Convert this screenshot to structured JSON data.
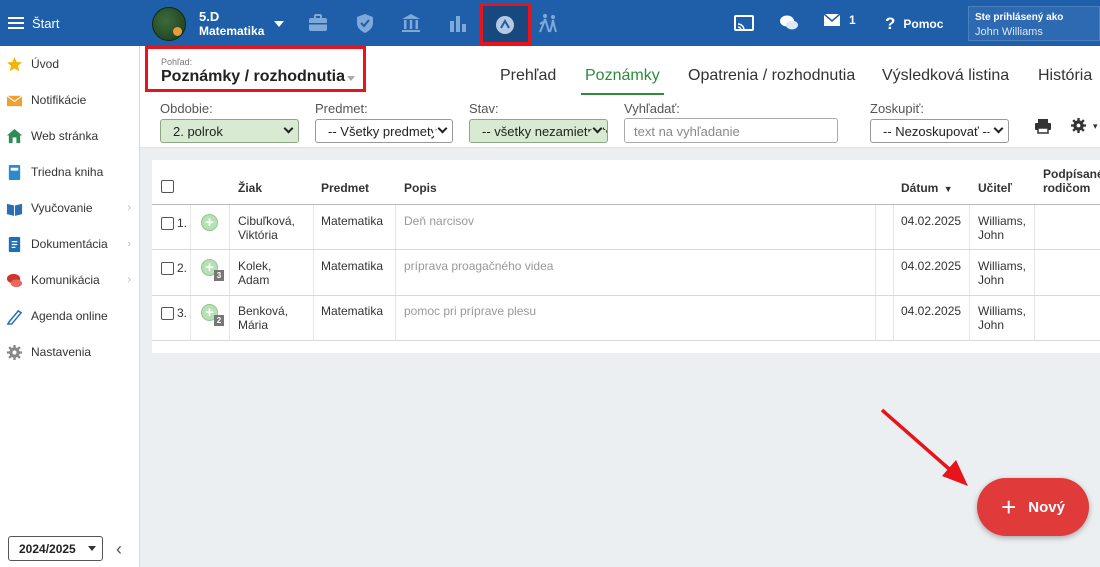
{
  "topbar": {
    "start_label": "Štart",
    "class_line1": "5.D",
    "class_line2": "Matematika",
    "messages_count": "1",
    "help_label": "Pomoc",
    "logged_as_label": "Ste prihlásený ako",
    "user_name": "John Williams"
  },
  "sidebar": {
    "items": [
      {
        "label": "Úvod",
        "icon": "star-icon"
      },
      {
        "label": "Notifikácie",
        "icon": "envelope-icon"
      },
      {
        "label": "Web stránka",
        "icon": "house-icon"
      },
      {
        "label": "Triedna kniha",
        "icon": "book-icon"
      },
      {
        "label": "Vyučovanie",
        "icon": "open-book-icon"
      },
      {
        "label": "Dokumentácia",
        "icon": "document-icon"
      },
      {
        "label": "Komunikácia",
        "icon": "chat-icon"
      },
      {
        "label": "Agenda online",
        "icon": "pen-icon"
      },
      {
        "label": "Nastavenia",
        "icon": "gear-icon"
      }
    ],
    "school_year": "2024/2025"
  },
  "view": {
    "label": "Pohľad:",
    "value": "Poznámky / rozhodnutia"
  },
  "tabs": [
    {
      "label": "Prehľad",
      "active": false
    },
    {
      "label": "Poznámky",
      "active": true
    },
    {
      "label": "Opatrenia / rozhodnutia",
      "active": false
    },
    {
      "label": "Výsledková listina",
      "active": false
    },
    {
      "label": "História",
      "active": false
    }
  ],
  "filters": {
    "obdobie_label": "Obdobie:",
    "obdobie_value": "2. polrok",
    "predmet_label": "Predmet:",
    "predmet_value": "-- Všetky predmety --",
    "stav_label": "Stav:",
    "stav_value": "-- všetky nezamietnuté --",
    "search_label": "Vyhľadať:",
    "search_placeholder": "text na vyhľadanie",
    "group_label": "Zoskupiť:",
    "group_value": "-- Nezoskupovať --"
  },
  "table": {
    "headers": {
      "student": "Žiak",
      "subject": "Predmet",
      "description": "Popis",
      "date": "Dátum",
      "teacher": "Učiteľ",
      "signed_1": "Podpísané",
      "signed_2": "rodičom"
    },
    "rows": [
      {
        "num": "1.",
        "student_1": "Cibuľková,",
        "student_2": "Viktória",
        "subject": "Matematika",
        "description": "Deň narcisov",
        "date": "04.02.2025",
        "teacher_1": "Williams,",
        "teacher_2": "John",
        "badge": ""
      },
      {
        "num": "2.",
        "student_1": "Kolek,",
        "student_2": "Adam",
        "subject": "Matematika",
        "description": "príprava proagačného videa",
        "date": "04.02.2025",
        "teacher_1": "Williams,",
        "teacher_2": "John",
        "badge": "3"
      },
      {
        "num": "3.",
        "student_1": "Benková,",
        "student_2": "Mária",
        "subject": "Matematika",
        "description": "pomoc pri príprave plesu",
        "date": "04.02.2025",
        "teacher_1": "Williams,",
        "teacher_2": "John",
        "badge": "2"
      }
    ]
  },
  "new_button_label": "Nový",
  "colors": {
    "topbar": "#1f5ea8",
    "active_tab": "#2e8b3e",
    "highlight": "#e8141c",
    "new_button": "#e03a3a"
  }
}
